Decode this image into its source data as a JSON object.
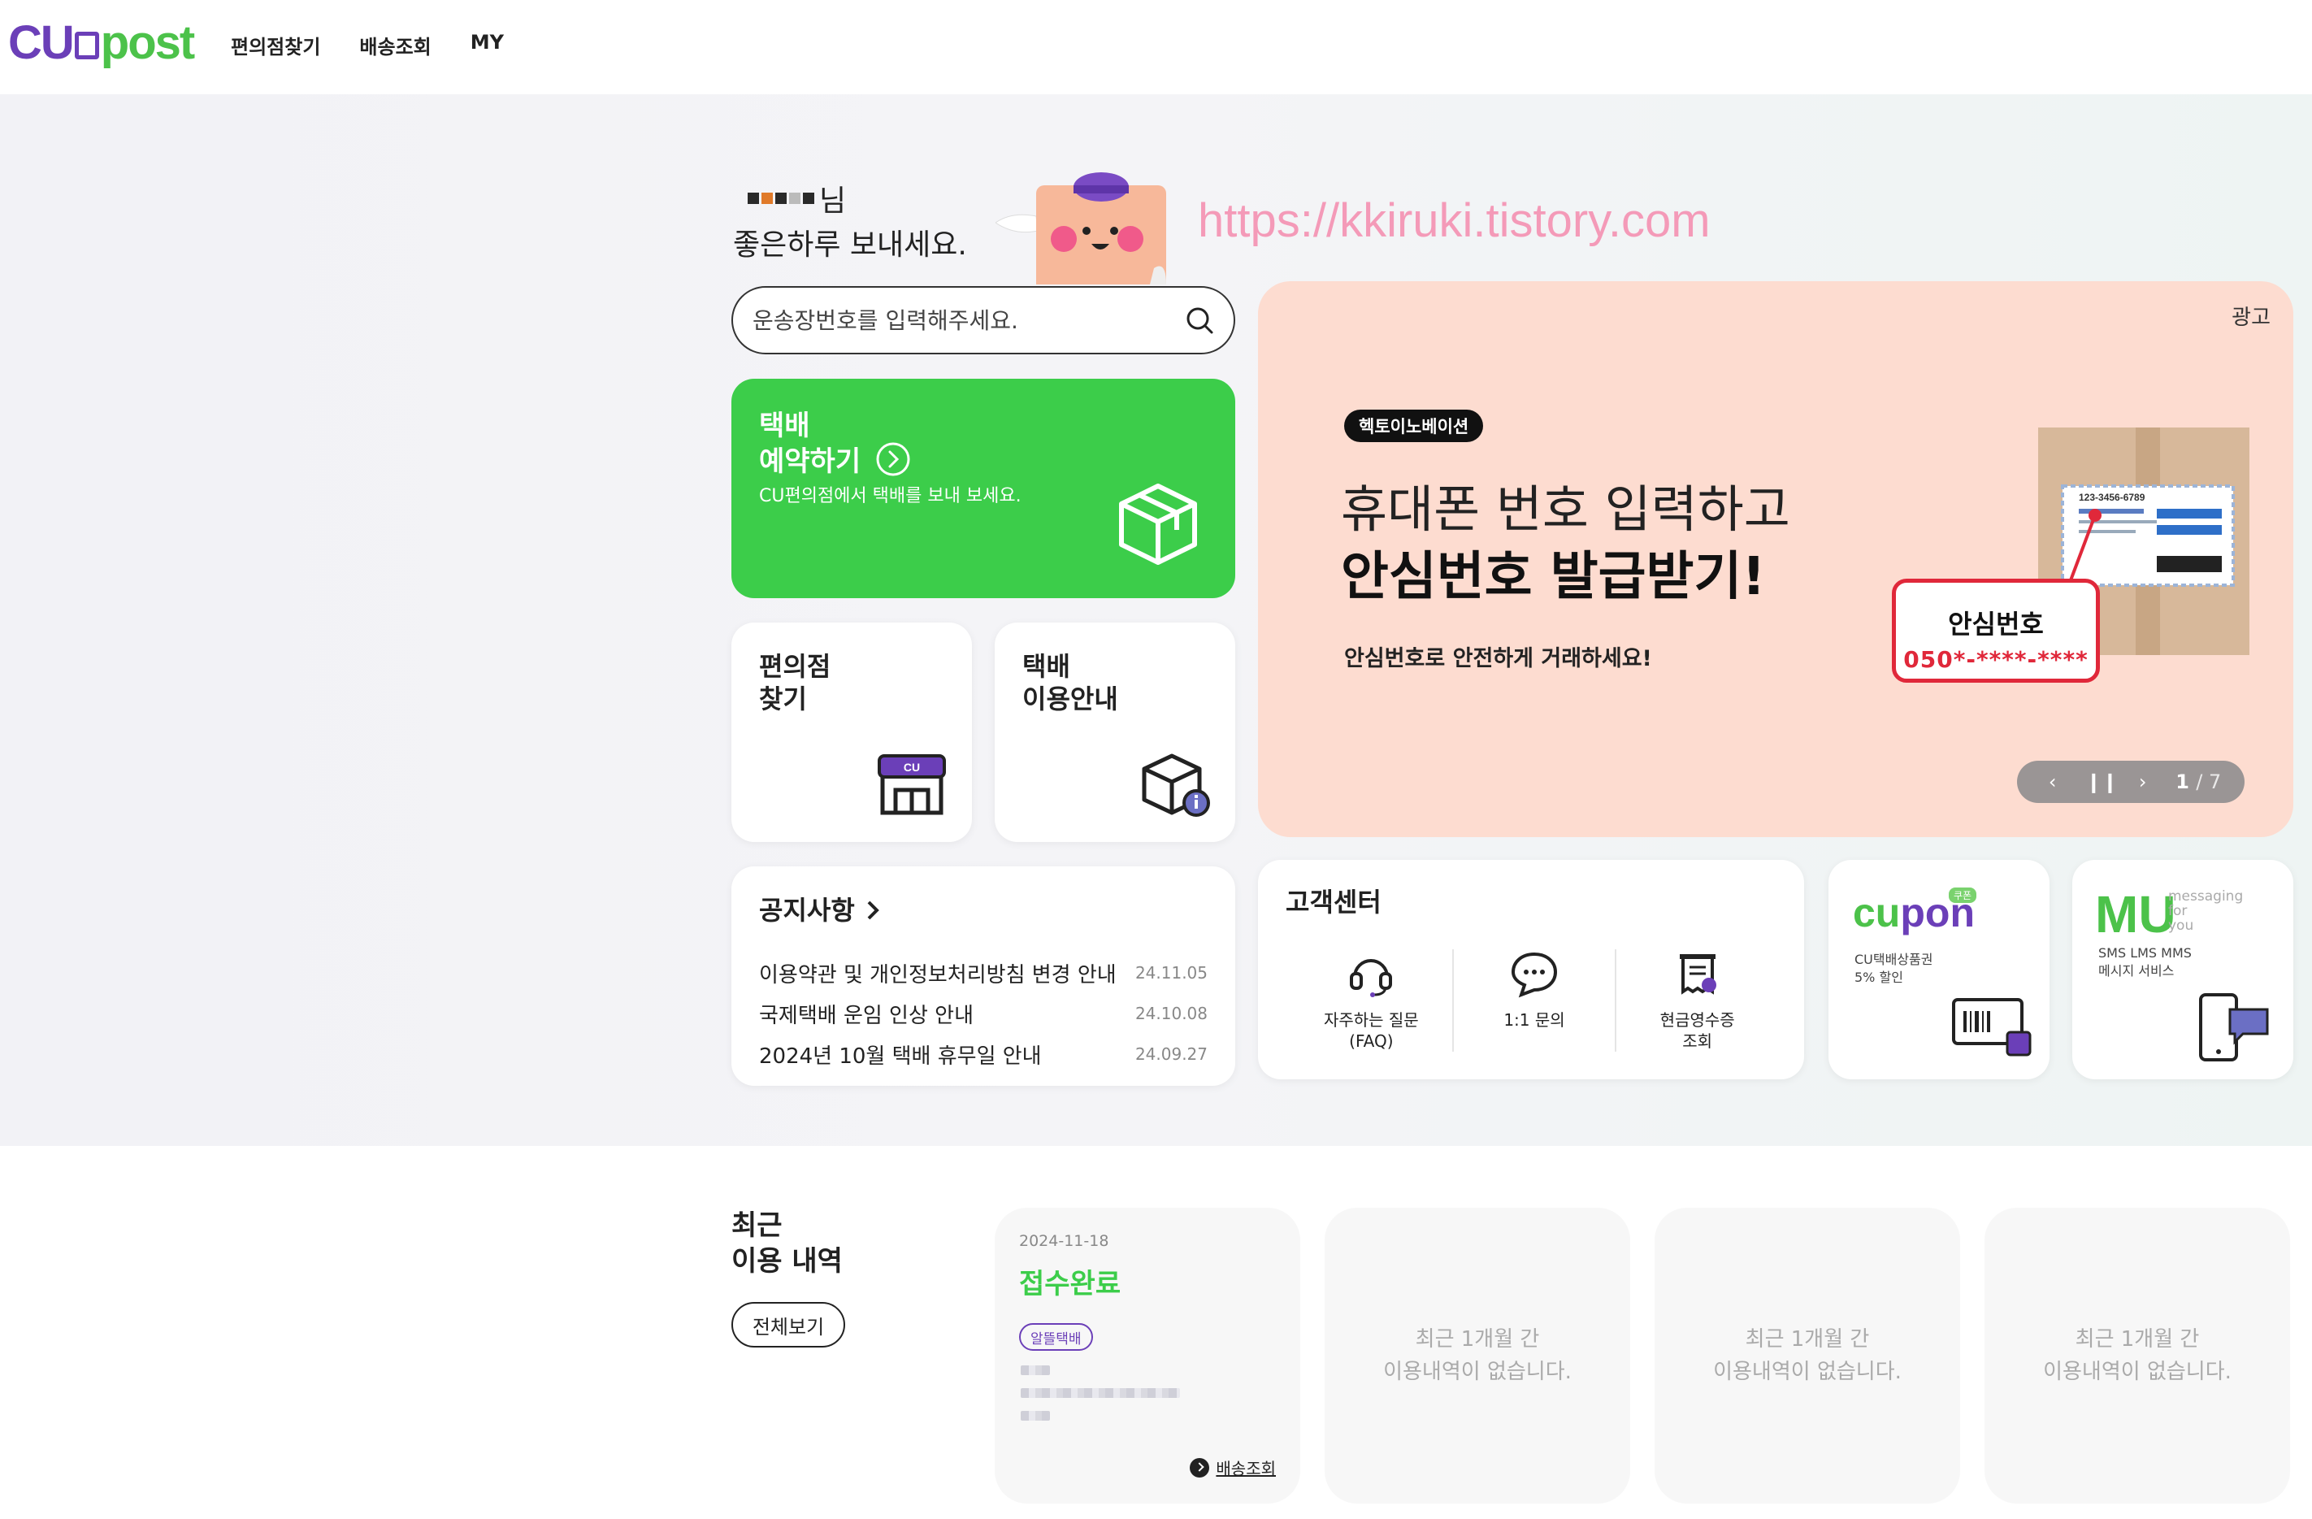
{
  "header": {
    "logo_left": "CU",
    "logo_right": "post",
    "nav": [
      "편의점찾기",
      "배송조회",
      "MY"
    ]
  },
  "greeting": {
    "name_suffix": "님",
    "line": "좋은하루 보내세요."
  },
  "watermark": "https://kkiruki.tistory.com",
  "search": {
    "placeholder": "운송장번호를 입력해주세요."
  },
  "reserve_card": {
    "line1": "택배",
    "line2": "예약하기",
    "sub": "CU편의점에서 택배를 보내 보세요."
  },
  "store_card": {
    "line1": "편의점",
    "line2": "찾기",
    "badge": "CU"
  },
  "guide_card": {
    "line1": "택배",
    "line2": "이용안내"
  },
  "notice": {
    "title": "공지사항",
    "items": [
      {
        "text": "이용약관 및 개인정보처리방침 변경 안내",
        "date": "24.11.05"
      },
      {
        "text": "국제택배 운임 인상 안내",
        "date": "24.10.08"
      },
      {
        "text": "2024년 10월 택배 휴무일 안내",
        "date": "24.09.27"
      }
    ]
  },
  "banner": {
    "ad_label": "광고",
    "brand": "헥토이노베이션",
    "headline1": "휴대폰 번호 입력하고",
    "headline2": "안심번호 발급받기!",
    "sub": "안심번호로 안전하게 거래하세요!",
    "safe_title": "안심번호",
    "safe_number": "050*-****-****",
    "label_number": "123-3456-6789",
    "current": "1",
    "total": "/ 7"
  },
  "customer_center": {
    "title": "고객센터",
    "items": [
      "자주하는 질문\n(FAQ)",
      "1:1 문의",
      "현금영수증\n조회"
    ]
  },
  "cupon": {
    "logo_a": "cu",
    "logo_b": "pon",
    "tag": "쿠폰",
    "desc1": "CU택배상품권",
    "desc2": "5% 할인"
  },
  "mu": {
    "logo": "MU",
    "tag1": "messaging",
    "tag2": "for",
    "tag3": "you",
    "desc1": "SMS LMS MMS",
    "desc2": "메시지 서비스"
  },
  "recent": {
    "title1": "최근",
    "title2": "이용 내역",
    "all_button": "전체보기",
    "first": {
      "date": "2024-11-18",
      "status": "접수완료",
      "badge": "알뜰택배",
      "link": "배송조회"
    },
    "empty_text": "최근 1개월 간\n이용내역이 없습니다."
  },
  "colors": {
    "brand_purple": "#6b3fb8",
    "brand_green": "#4cc24a",
    "reserve_green": "#3ccd4a",
    "banner_bg": "#fddcd0",
    "alert_red": "#e0283a"
  }
}
